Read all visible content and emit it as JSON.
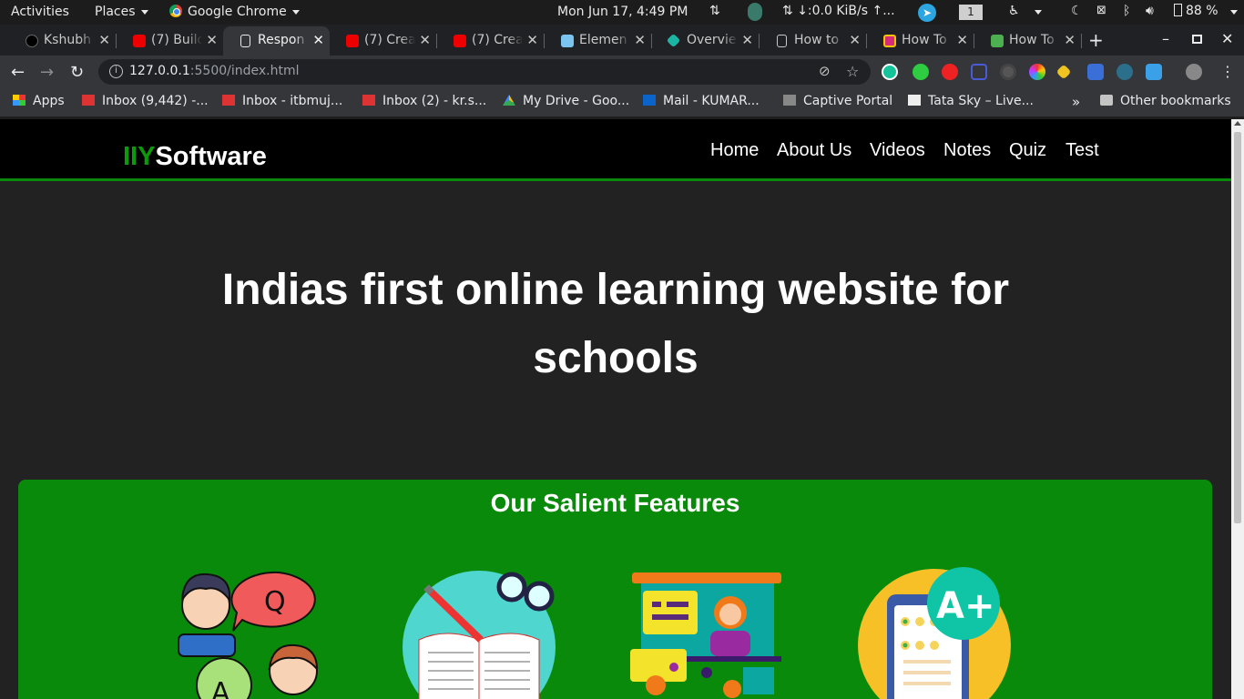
{
  "system_bar": {
    "activities": "Activities",
    "places": "Places",
    "app": "Google Chrome",
    "clock": "Mon Jun 17,  4:49 PM",
    "net_speed": "↓:0.0 KiB/s ↑...",
    "workspace": "1",
    "battery": "88 %"
  },
  "tabs": [
    {
      "title": "Kshubh",
      "icon": "github-icon"
    },
    {
      "title": "(7) Build",
      "icon": "youtube-icon"
    },
    {
      "title": "Respon",
      "icon": "page-icon",
      "active": true
    },
    {
      "title": "(7) Crea",
      "icon": "youtube-icon"
    },
    {
      "title": "(7) Crea",
      "icon": "youtube-icon"
    },
    {
      "title": "Elemen",
      "icon": "element-icon"
    },
    {
      "title": "Overvie",
      "icon": "overview-icon"
    },
    {
      "title": "How to",
      "icon": "page-icon"
    },
    {
      "title": "How To",
      "icon": "ht-icon"
    },
    {
      "title": "How To",
      "icon": "ht-green-icon"
    }
  ],
  "address_bar": {
    "host": "127.0.0.1",
    "rest": ":5500/index.html"
  },
  "bookmarks": [
    {
      "label": "Apps",
      "icon": "apps-grid-icon"
    },
    {
      "label": "Inbox (9,442) -...",
      "icon": "gmail-icon"
    },
    {
      "label": "Inbox - itbmuj...",
      "icon": "gmail-icon"
    },
    {
      "label": "Inbox (2) - kr.s...",
      "icon": "gmail-icon"
    },
    {
      "label": "My Drive - Goo...",
      "icon": "drive-icon"
    },
    {
      "label": "Mail - KUMAR...",
      "icon": "outlook-icon"
    },
    {
      "label": "Captive Portal",
      "icon": "portal-icon"
    },
    {
      "label": "Tata Sky – Live...",
      "icon": "tatasky-icon"
    }
  ],
  "bookmarks_more": "»",
  "other_bookmarks": "Other bookmarks",
  "site": {
    "logo_accent": "IIY",
    "logo_rest": "Software",
    "nav": [
      "Home",
      "About Us",
      "Videos",
      "Notes",
      "Quiz",
      "Test"
    ],
    "hero_line1": "Indias first online learning website for",
    "hero_line2": "schools",
    "features_title": "Our Salient Features"
  },
  "colors": {
    "brand_green": "#0a8a0a",
    "nav_bg": "#000000",
    "page_bg": "#222222"
  }
}
